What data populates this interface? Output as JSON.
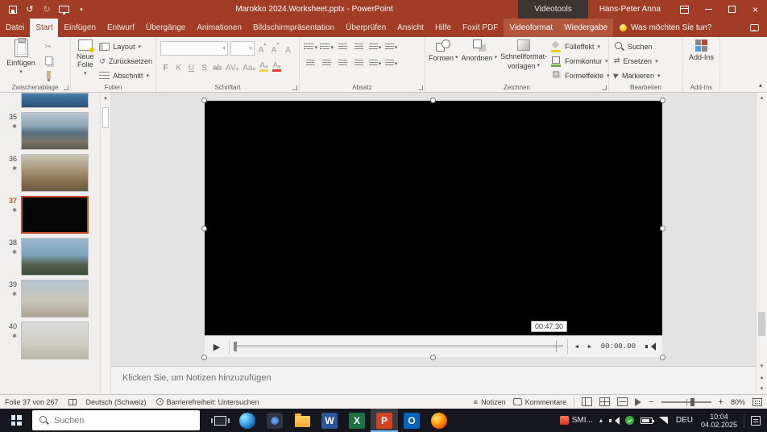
{
  "icons": {
    "chevron_down": "▾",
    "chevron_up": "▴",
    "play": "▶",
    "undo": "↺",
    "redo": "↻",
    "scissors": "✂",
    "star": "✱",
    "close": "×",
    "menu": "≡",
    "step_back": "◄",
    "step_fwd": "►",
    "minus": "−",
    "plus": "+",
    "swap": "⇄"
  },
  "titlebar": {
    "title": "Marokko 2024.Worksheet.pptx - PowerPoint",
    "contextual_label": "Videotools",
    "user_name": "Hans-Peter Anna"
  },
  "ribbon": {
    "tabs": [
      "Datei",
      "Start",
      "Einfügen",
      "Entwurf",
      "Übergänge",
      "Animationen",
      "Bildschirmpräsentation",
      "Überprüfen",
      "Ansicht",
      "Hilfe",
      "Foxit PDF",
      "Videoformat",
      "Wiedergabe"
    ],
    "tell_me": "Was möchten Sie tun?",
    "clipboard": {
      "label": "Zwischenablage",
      "paste": "Einfügen"
    },
    "slides": {
      "label": "Folien",
      "new_slide": "Neue Folie",
      "layout": "Layout",
      "reset": "Zurücksetzen",
      "section": "Abschnitt"
    },
    "font": {
      "label": "Schriftart",
      "bold": "F",
      "italic": "K",
      "underline": "U",
      "shadow": "S",
      "strike": "ab",
      "spacing": "AV",
      "case": "Aa",
      "grow": "A",
      "shrink": "A",
      "clear": "A",
      "highlight": "A",
      "color": "A"
    },
    "paragraph": {
      "label": "Absatz"
    },
    "drawing": {
      "label": "Zeichnen",
      "shapes": "Formen",
      "arrange": "Anordnen",
      "styles_line1": "Schnellformat-",
      "styles_line2": "vorlagen",
      "fill": "Fülleffekt",
      "outline": "Formkontur",
      "effects": "Formeffekte"
    },
    "editing": {
      "label": "Bearbeiten",
      "find": "Suchen",
      "replace": "Ersetzen",
      "select": "Markieren"
    },
    "addins": {
      "label": "Add-Ins",
      "button": "Add-Ins"
    }
  },
  "slide_panel": {
    "slides": [
      "35",
      "36",
      "37",
      "38",
      "39",
      "40"
    ]
  },
  "video": {
    "current_time": "00:00.00",
    "tooltip_time": "00:47.30"
  },
  "notes": {
    "placeholder": "Klicken Sie, um Notizen hinzuzufügen"
  },
  "statusbar": {
    "slide_info": "Folie 37 von 267",
    "language": "Deutsch (Schweiz)",
    "accessibility": "Barrierefreiheit: Untersuchen",
    "notes": "Notizen",
    "comments": "Kommentare",
    "zoom_level": "80%"
  },
  "taskbar": {
    "search_placeholder": "Suchen",
    "tray_label": "SMI...",
    "keyboard_language": "DEU",
    "time": "10:04",
    "date": "04.02.2025",
    "app_letters": {
      "word": "W",
      "excel": "X",
      "powerpoint": "P",
      "outlook": "O"
    }
  }
}
